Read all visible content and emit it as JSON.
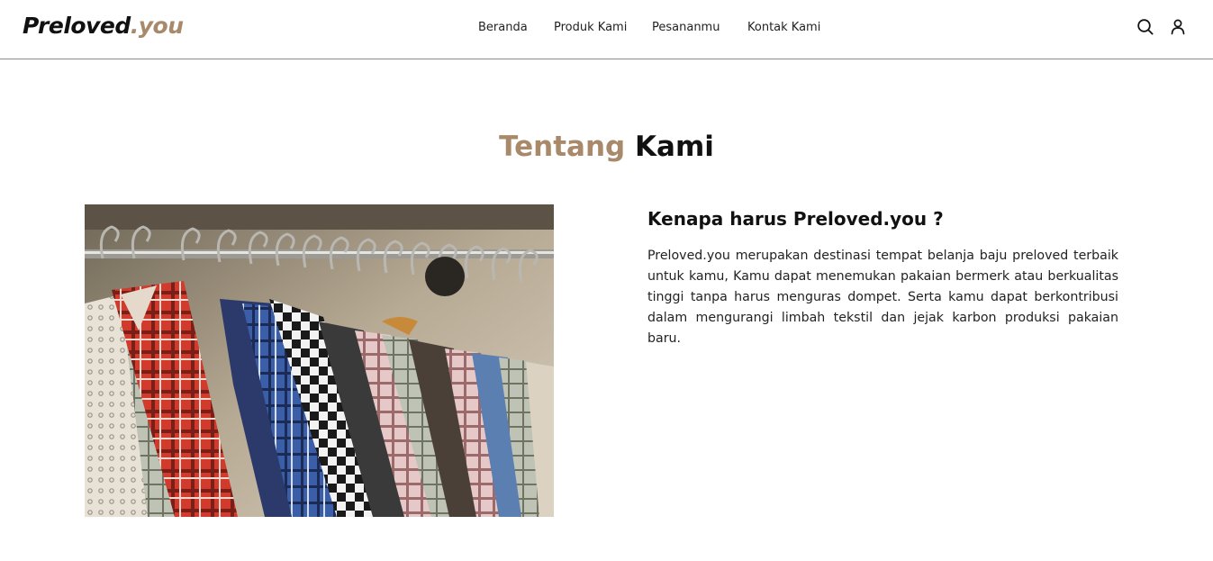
{
  "header": {
    "logo": {
      "main": "Preloved",
      "suffix": ".you"
    },
    "nav": [
      {
        "label": "Beranda"
      },
      {
        "label": "Produk Kami"
      },
      {
        "label": "Pesananmu"
      },
      {
        "label": "Kontak Kami"
      }
    ],
    "icons": {
      "search": "search-icon",
      "account": "user-icon"
    }
  },
  "about": {
    "title_accent": "Tentang",
    "title_rest": "Kami",
    "heading": "Kenapa harus Preloved.you ?",
    "body": "Preloved.you merupakan destinasi tempat belanja baju preloved terbaik untuk kamu, Kamu dapat menemukan pakaian bermerk atau berkualitas tinggi tanpa harus menguras dompet. Serta kamu dapat berkontribusi dalam mengurangi limbah tekstil dan jejak karbon produksi pakaian baru."
  },
  "colors": {
    "accent": "#a8896a",
    "text": "#111111",
    "header_border": "#8c8c8c"
  }
}
